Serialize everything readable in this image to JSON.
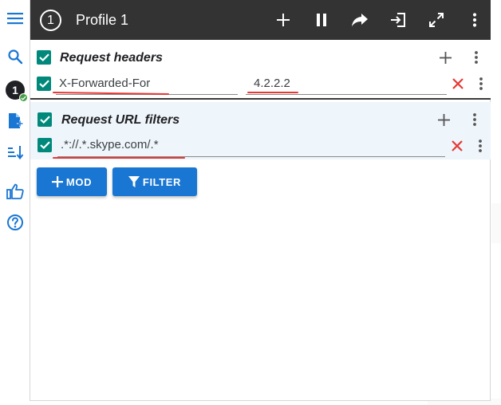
{
  "topbar": {
    "profile_number": "1",
    "profile_title": "Profile 1"
  },
  "rail": {
    "active_profile_number": "1"
  },
  "request_headers": {
    "title": "Request headers",
    "rows": [
      {
        "name": "X-Forwarded-For",
        "value": "4.2.2.2",
        "enabled": true
      }
    ]
  },
  "request_url_filters": {
    "title": "Request URL filters",
    "rows": [
      {
        "pattern": ".*://.*.skype.com/.*",
        "enabled": true
      }
    ]
  },
  "actions": {
    "mod_label": "MOD",
    "filter_label": "FILTER"
  },
  "colors": {
    "topbar": "#333333",
    "accent_blue": "#1976d2",
    "checkbox_teal": "#00897b",
    "delete_red": "#e53935",
    "filter_section_bg": "#eef5fb"
  }
}
